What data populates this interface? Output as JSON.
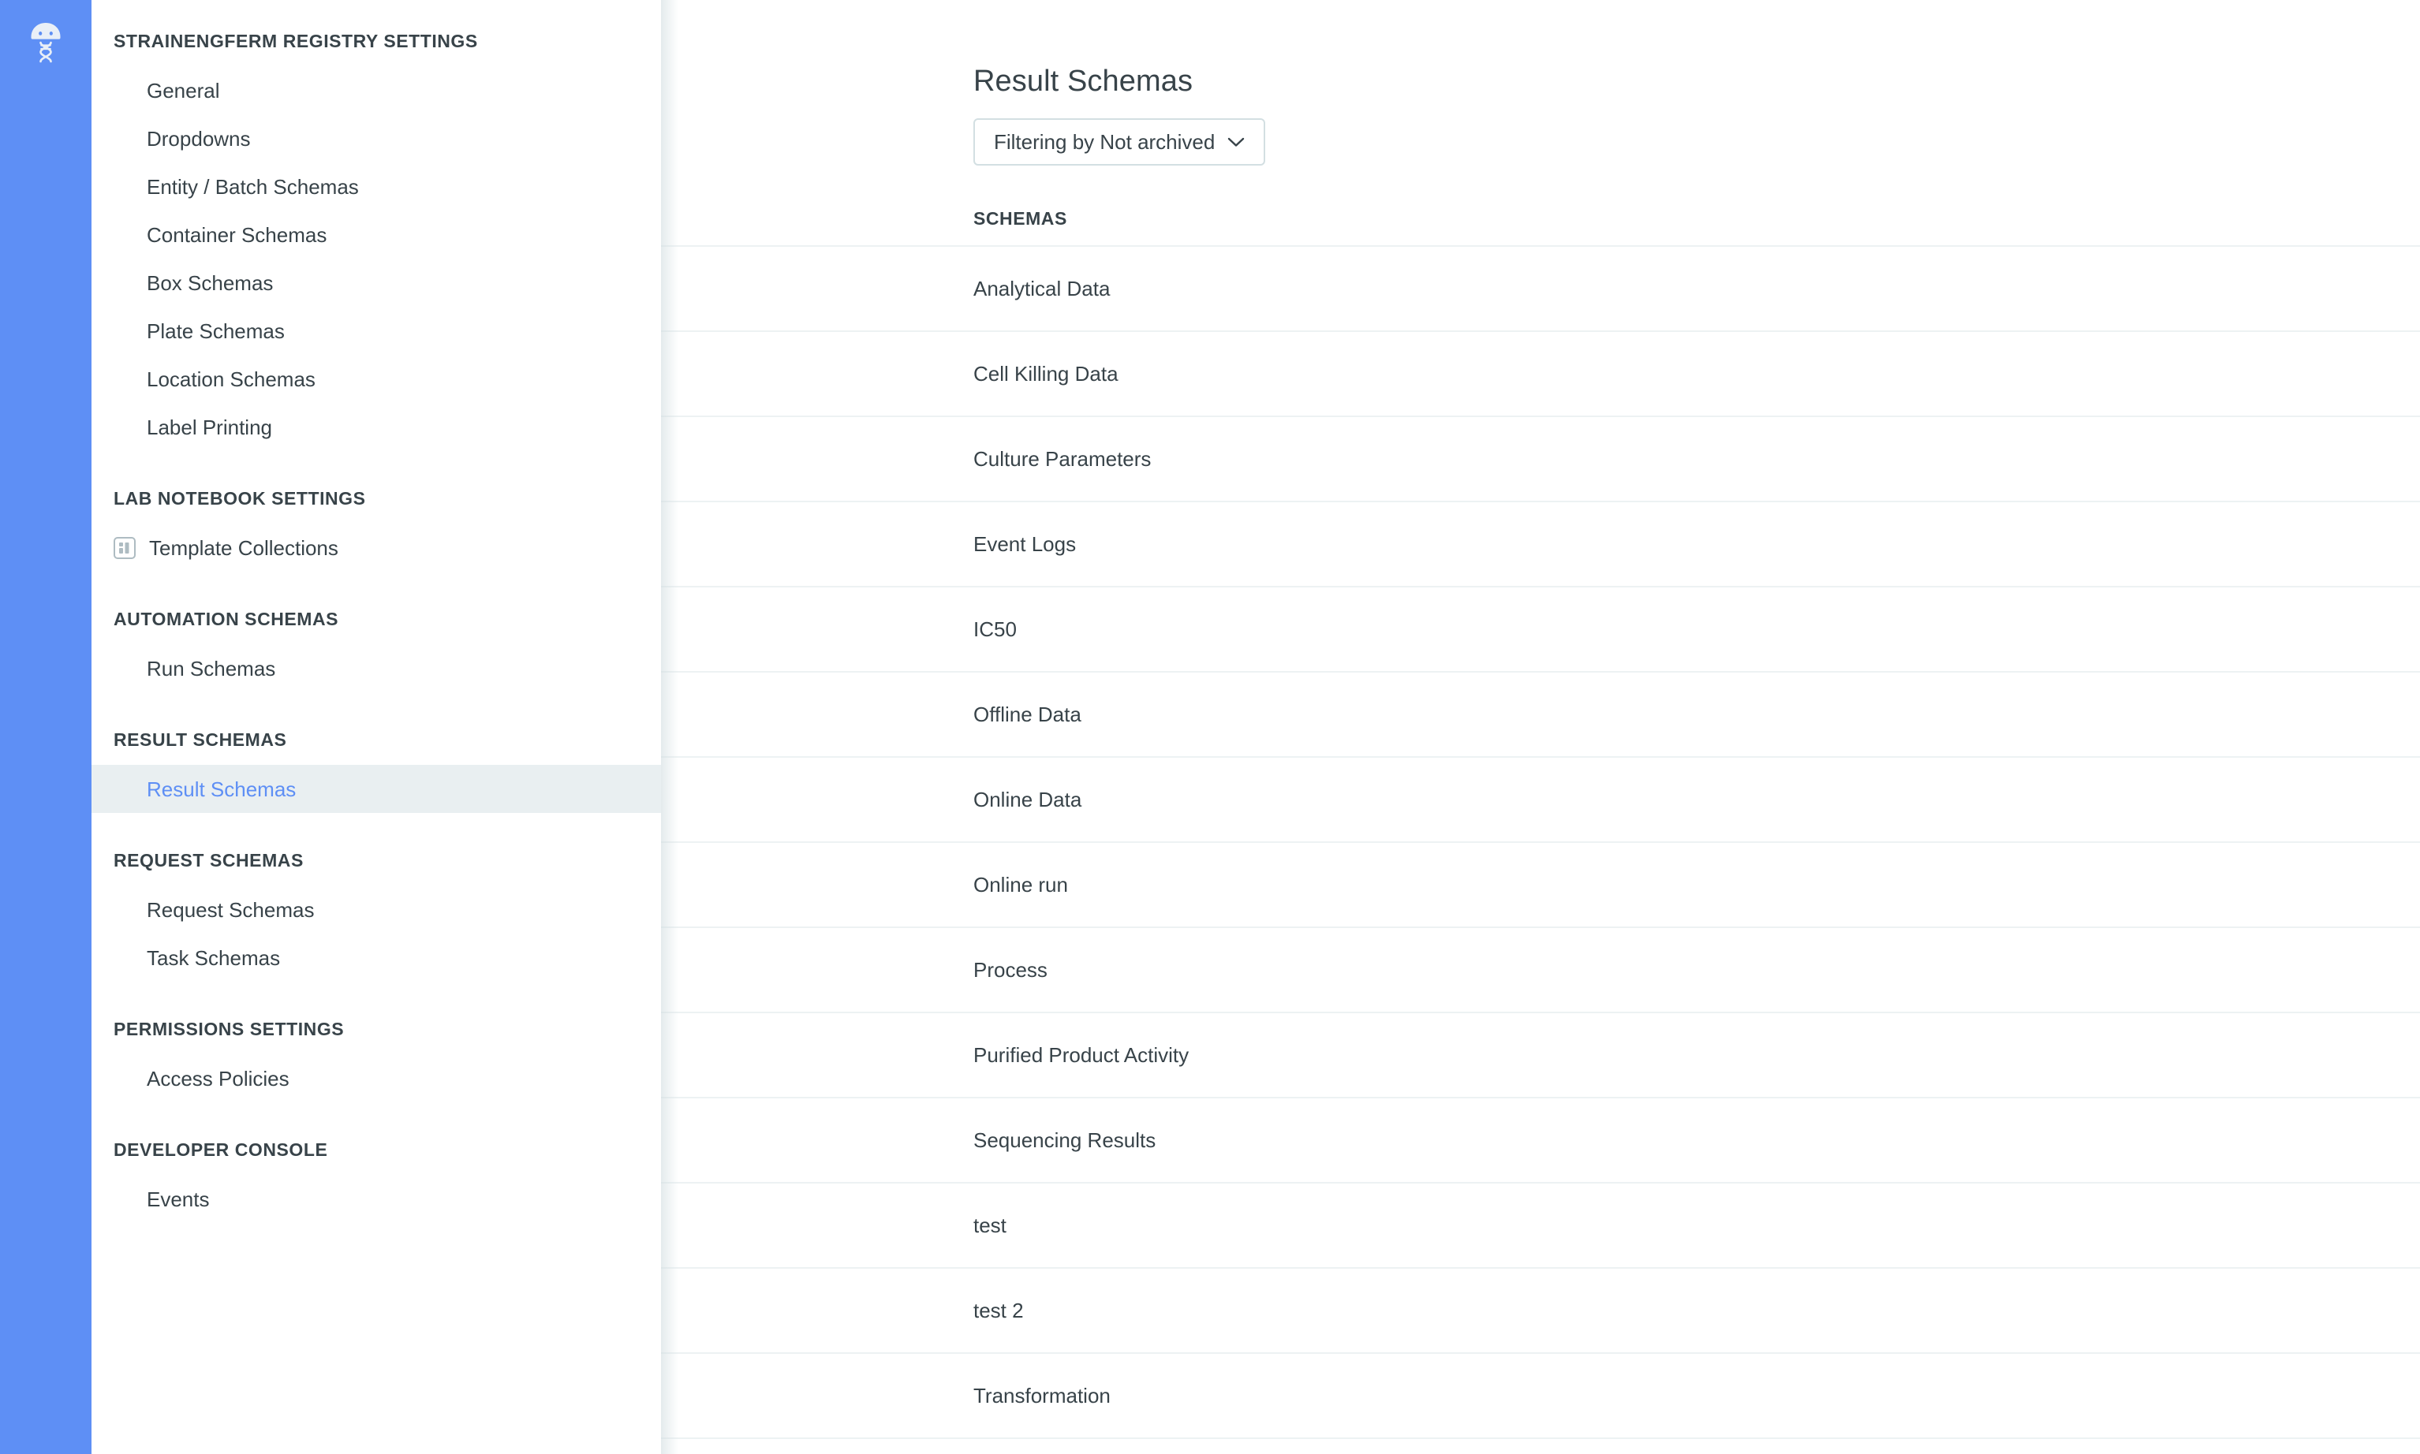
{
  "rail": {
    "logo_name": "benchling-logo"
  },
  "sidebar": {
    "groups": [
      {
        "title": "STRAINENGFERM REGISTRY SETTINGS",
        "items": [
          {
            "label": "General",
            "icon": null,
            "selected": false
          },
          {
            "label": "Dropdowns",
            "icon": null,
            "selected": false
          },
          {
            "label": "Entity / Batch Schemas",
            "icon": null,
            "selected": false
          },
          {
            "label": "Container Schemas",
            "icon": null,
            "selected": false
          },
          {
            "label": "Box Schemas",
            "icon": null,
            "selected": false
          },
          {
            "label": "Plate Schemas",
            "icon": null,
            "selected": false
          },
          {
            "label": "Location Schemas",
            "icon": null,
            "selected": false
          },
          {
            "label": "Label Printing",
            "icon": null,
            "selected": false
          }
        ]
      },
      {
        "title": "LAB NOTEBOOK SETTINGS",
        "items": [
          {
            "label": "Template Collections",
            "icon": "template-collections-icon",
            "selected": false
          }
        ]
      },
      {
        "title": "AUTOMATION SCHEMAS",
        "items": [
          {
            "label": "Run Schemas",
            "icon": null,
            "selected": false
          }
        ]
      },
      {
        "title": "RESULT SCHEMAS",
        "items": [
          {
            "label": "Result Schemas",
            "icon": null,
            "selected": true
          }
        ]
      },
      {
        "title": "REQUEST SCHEMAS",
        "items": [
          {
            "label": "Request Schemas",
            "icon": null,
            "selected": false
          },
          {
            "label": "Task Schemas",
            "icon": null,
            "selected": false
          }
        ]
      },
      {
        "title": "PERMISSIONS SETTINGS",
        "items": [
          {
            "label": "Access Policies",
            "icon": null,
            "selected": false
          }
        ]
      },
      {
        "title": "DEVELOPER CONSOLE",
        "items": [
          {
            "label": "Events",
            "icon": null,
            "selected": false
          }
        ]
      }
    ]
  },
  "main": {
    "page_title": "Result Schemas",
    "filter": {
      "label": "Filtering by Not archived",
      "chevron_icon": "chevron-down-icon"
    },
    "list_header": "SCHEMAS",
    "schemas": [
      "Analytical Data",
      "Cell Killing Data",
      "Culture Parameters",
      "Event Logs",
      "IC50",
      "Offline Data",
      "Online Data",
      "Online run",
      "Process",
      "Purified Product Activity",
      "Sequencing Results",
      "test",
      "test 2",
      "Transformation"
    ]
  },
  "colors": {
    "rail_blue": "#5e8ff5",
    "accent_blue": "#5e8ff5",
    "text_primary": "#384349",
    "selected_row_bg": "#e9eff1",
    "divider": "#edf2f3",
    "border": "#d3dfe2"
  }
}
